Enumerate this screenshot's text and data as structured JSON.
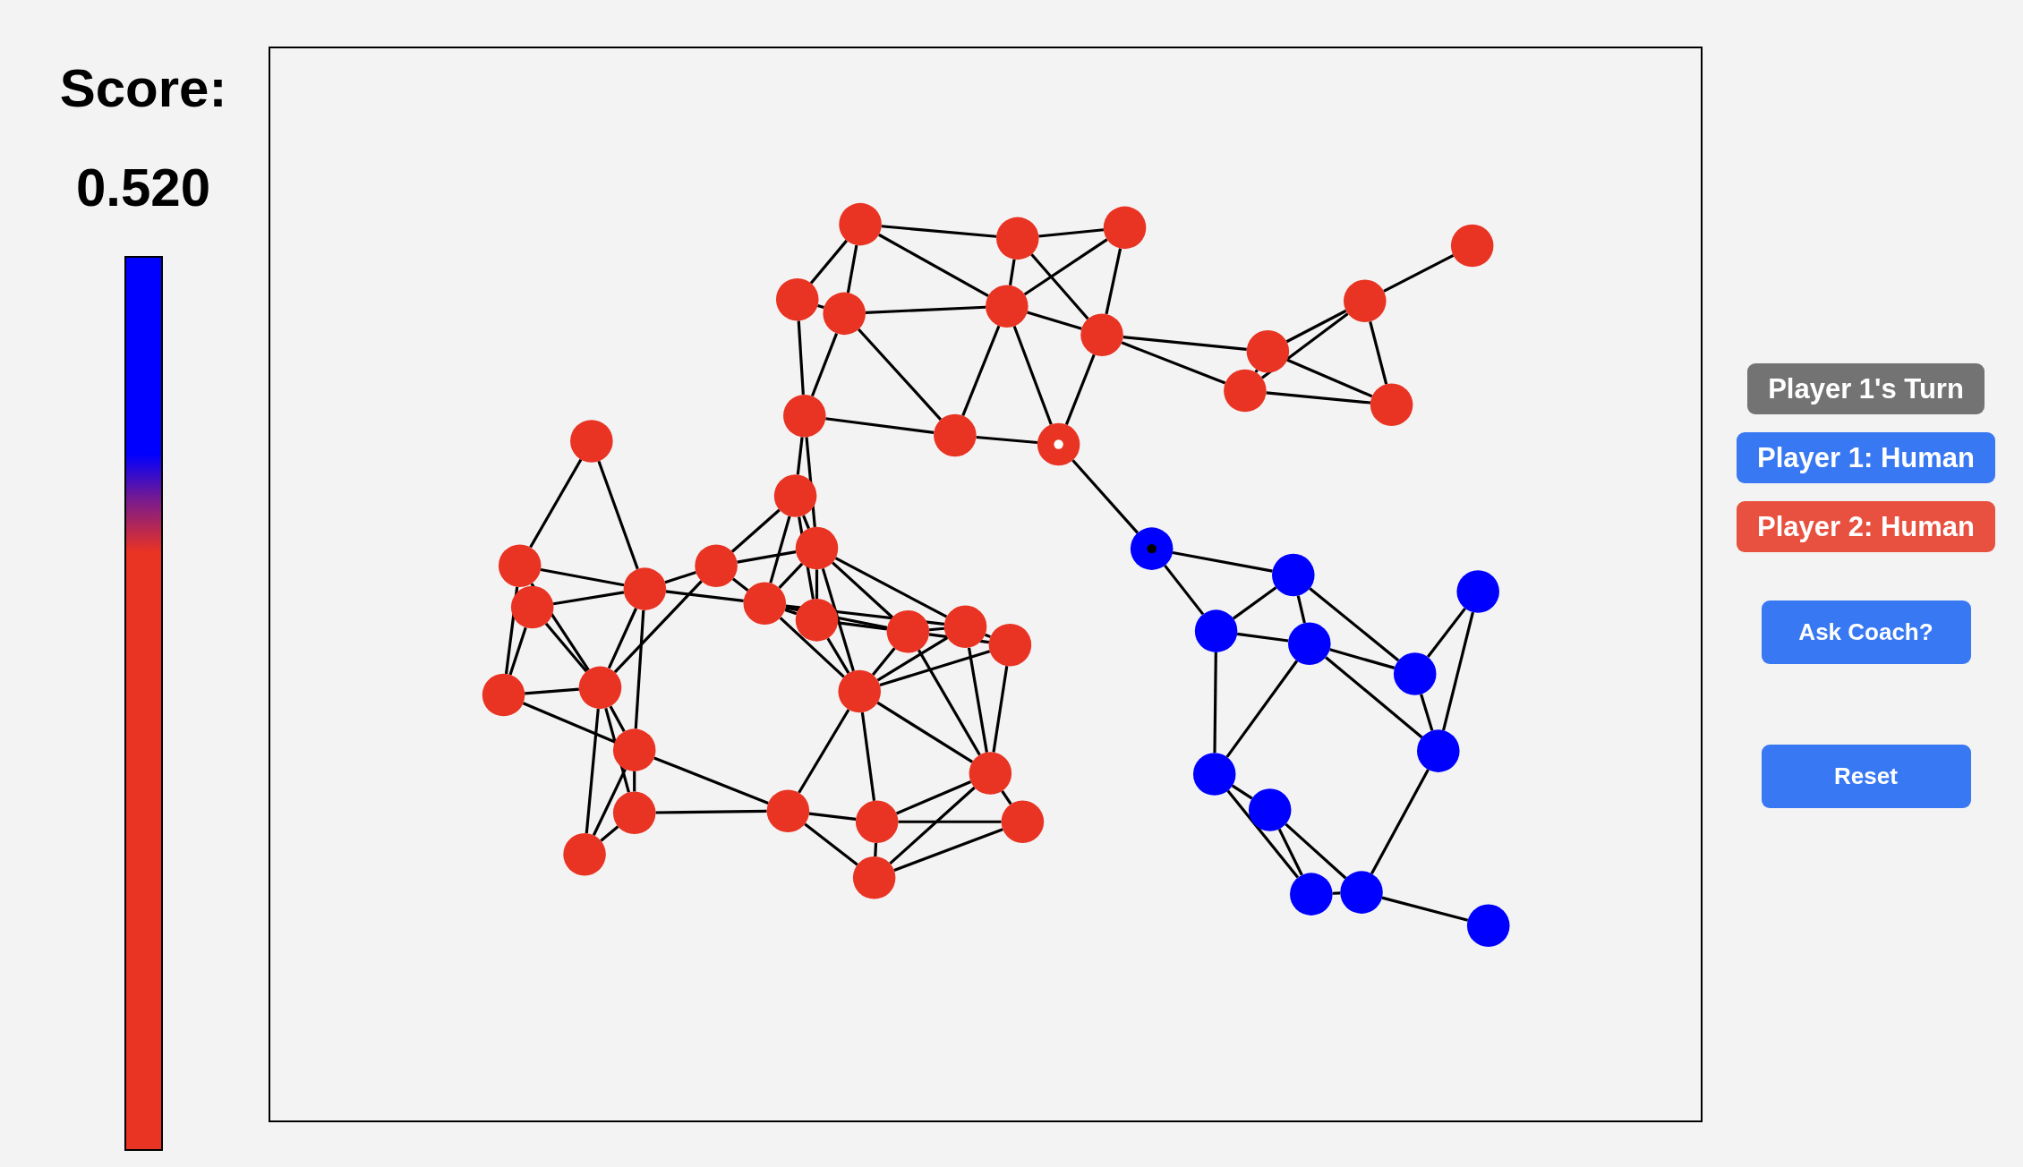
{
  "score": {
    "label": "Score:",
    "value": "0.520",
    "level": 0.27
  },
  "graph": {
    "nodes": [
      {
        "color": "#e93323",
        "marked": false
      },
      {
        "color": "#e93323",
        "marked": false
      },
      {
        "color": "#e93323",
        "marked": false
      },
      {
        "color": "#e93323",
        "marked": false
      },
      {
        "color": "#e93323",
        "marked": false
      },
      {
        "color": "#e93323",
        "marked": false
      },
      {
        "color": "#e93323",
        "marked": false
      },
      {
        "color": "#e93323",
        "marked": false
      },
      {
        "color": "#e93323",
        "marked": false
      },
      {
        "color": "#e93323",
        "marked": true
      },
      {
        "color": "#e93323",
        "marked": false
      },
      {
        "color": "#e93323",
        "marked": false
      },
      {
        "color": "#e93323",
        "marked": false
      },
      {
        "color": "#e93323",
        "marked": false
      },
      {
        "color": "#e93323",
        "marked": false
      },
      {
        "color": "#e93323",
        "marked": false
      },
      {
        "color": "#e93323",
        "marked": false
      },
      {
        "color": "#e93323",
        "marked": false
      },
      {
        "color": "#e93323",
        "marked": false
      },
      {
        "color": "#e93323",
        "marked": false
      },
      {
        "color": "#e93323",
        "marked": false
      },
      {
        "color": "#e93323",
        "marked": false
      },
      {
        "color": "#e93323",
        "marked": false
      },
      {
        "color": "#e93323",
        "marked": false
      },
      {
        "color": "#e93323",
        "marked": false
      },
      {
        "color": "#e93323",
        "marked": false
      },
      {
        "color": "#e93323",
        "marked": false
      },
      {
        "color": "#e93323",
        "marked": false
      },
      {
        "color": "#e93323",
        "marked": false
      },
      {
        "color": "#e93323",
        "marked": false
      },
      {
        "color": "#e93323",
        "marked": false
      },
      {
        "color": "#e93323",
        "marked": false
      },
      {
        "color": "#e93323",
        "marked": false
      },
      {
        "color": "#e93323",
        "marked": false
      },
      {
        "color": "#e93323",
        "marked": false
      },
      {
        "color": "#e93323",
        "marked": false
      },
      {
        "color": "#e93323",
        "marked": false
      },
      {
        "color": "#e93323",
        "marked": false
      },
      {
        "color": "#0000ff",
        "marked": true
      },
      {
        "color": "#0000ff",
        "marked": false
      },
      {
        "color": "#0000ff",
        "marked": false
      },
      {
        "color": "#0000ff",
        "marked": false
      },
      {
        "color": "#0000ff",
        "marked": false
      },
      {
        "color": "#0000ff",
        "marked": false
      },
      {
        "color": "#0000ff",
        "marked": false
      },
      {
        "color": "#0000ff",
        "marked": false
      },
      {
        "color": "#0000ff",
        "marked": false
      },
      {
        "color": "#0000ff",
        "marked": false
      },
      {
        "color": "#0000ff",
        "marked": false
      },
      {
        "color": "#0000ff",
        "marked": false
      }
    ]
  },
  "turn": "Player 1's Turn",
  "players": [
    {
      "label": "Player 1: Human",
      "color": "#3878f3"
    },
    {
      "label": "Player 2: Human",
      "color": "#e8513f"
    }
  ],
  "buttons": [
    {
      "label": "Ask Coach?"
    },
    {
      "label": "Reset"
    }
  ]
}
